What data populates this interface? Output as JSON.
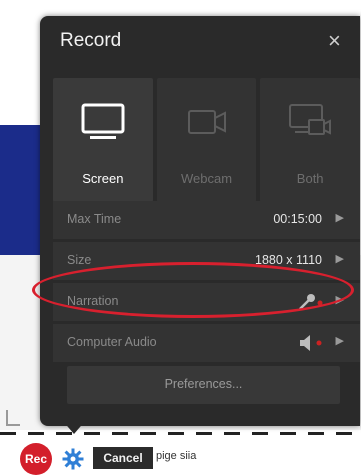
{
  "panel": {
    "title": "Record",
    "close_icon": "close-icon",
    "modes": [
      {
        "label": "Screen",
        "icon": "monitor-icon",
        "active": true
      },
      {
        "label": "Webcam",
        "icon": "webcam-icon",
        "active": false
      },
      {
        "label": "Both",
        "icon": "screen-and-webcam-icon",
        "active": false
      }
    ],
    "settings": [
      {
        "label": "Max Time",
        "value": "00:15:00"
      },
      {
        "label": "Size",
        "value": "1880 x 1110"
      },
      {
        "label": "Narration",
        "icon": "microphone-icon"
      },
      {
        "label": "Computer Audio",
        "icon": "speaker-icon"
      }
    ],
    "preferences_label": "Preferences..."
  },
  "toolbar": {
    "rec_label": "Rec",
    "settings_icon": "gear-icon",
    "cancel_label": "Cancel"
  },
  "background": {
    "text": "pige siia"
  },
  "colors": {
    "panel": "#2a2a2a",
    "row": "#333333",
    "highlight_ellipse": "#d8202e",
    "rec_button": "#d31f2b",
    "band": "#1b2c8a"
  }
}
